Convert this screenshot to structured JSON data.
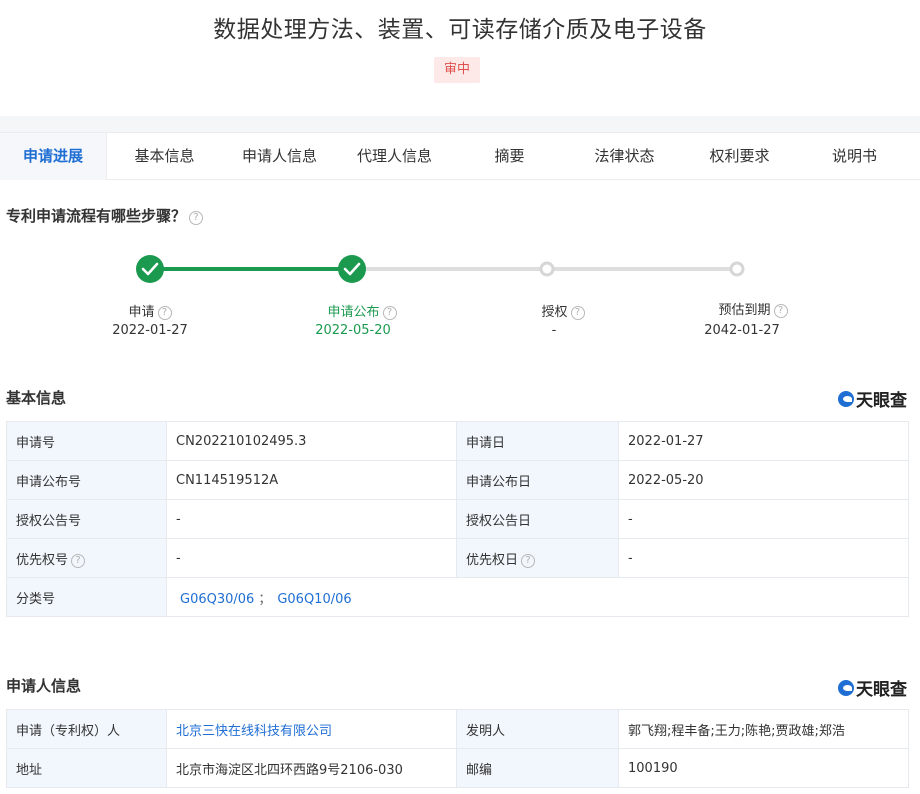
{
  "title": "数据处理方法、装置、可读存储介质及电子设备",
  "status_badge": "审中",
  "tabs": [
    "申请进展",
    "基本信息",
    "申请人信息",
    "代理人信息",
    "摘要",
    "法律状态",
    "权利要求",
    "说明书"
  ],
  "process_question": "专利申请流程有哪些步骤？",
  "steps": [
    {
      "label": "申请",
      "date": "2022-01-27",
      "done": true
    },
    {
      "label": "申请公布",
      "date": "2022-05-20",
      "done": true
    },
    {
      "label": "授权",
      "date": "-",
      "done": false
    },
    {
      "label": "预估到期",
      "date": "2042-01-27",
      "done": false
    }
  ],
  "brand": "天眼查",
  "basic_info": {
    "title": "基本信息",
    "rows": [
      {
        "k1": "申请号",
        "v1": "CN202210102495.3",
        "k2": "申请日",
        "v2": "2022-01-27"
      },
      {
        "k1": "申请公布号",
        "v1": "CN114519512A",
        "k2": "申请公布日",
        "v2": "2022-05-20"
      },
      {
        "k1": "授权公告号",
        "v1": "-",
        "k2": "授权公告日",
        "v2": "-"
      },
      {
        "k1": "优先权号",
        "v1": "-",
        "k2": "优先权日",
        "v2": "-"
      }
    ],
    "class_label": "分类号",
    "class_codes": [
      "G06Q30/06",
      "G06Q10/06"
    ],
    "class_sep": "；"
  },
  "applicant_info": {
    "title": "申请人信息",
    "applicant_label": "申请（专利权）人",
    "applicant_value": "北京三快在线科技有限公司",
    "inventor_label": "发明人",
    "inventor_value": "郭飞翔;程丰备;王力;陈艳;贾政雄;郑浩",
    "address_label": "地址",
    "address_value": "北京市海淀区北四环西路9号2106-030",
    "postcode_label": "邮编",
    "postcode_value": "100190"
  },
  "colors": {
    "accent": "#1f6ed4",
    "done": "#1b9a4f",
    "pending": "#d9d9d9",
    "badge": "#e0504d"
  }
}
